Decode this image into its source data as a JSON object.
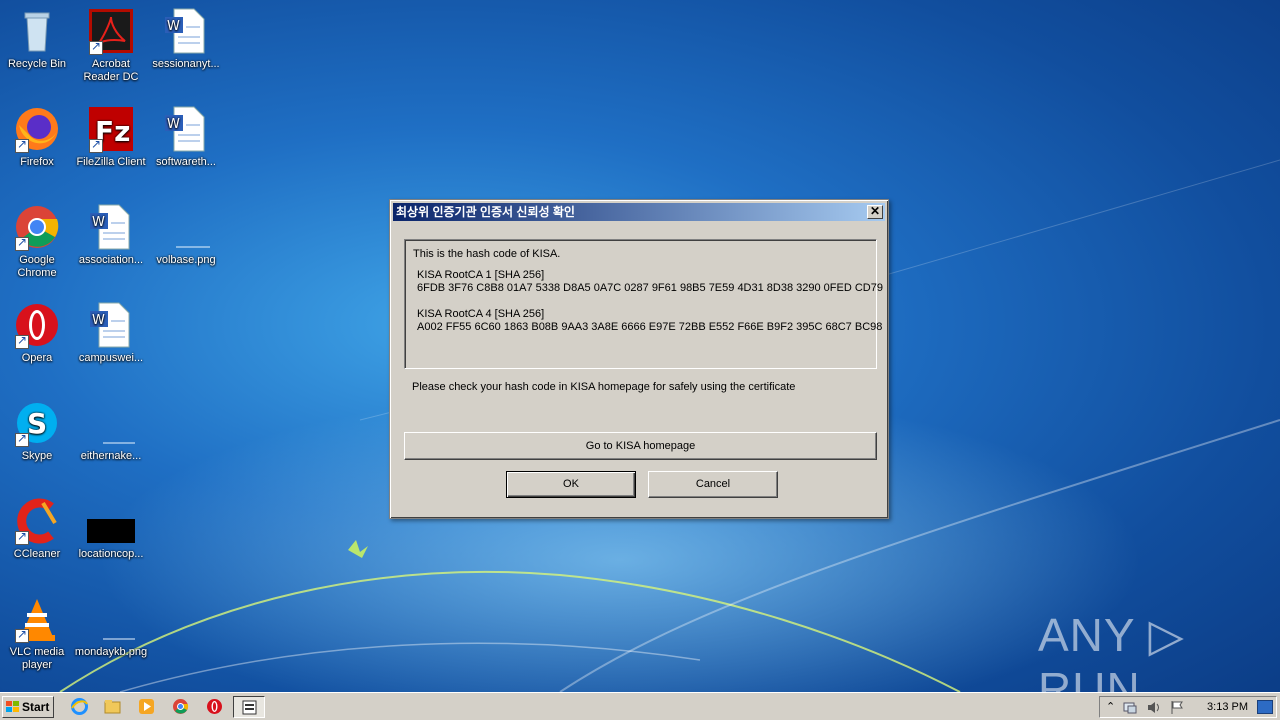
{
  "desktop": {
    "icons": [
      {
        "label_lines": [
          "Recycle Bin"
        ],
        "icon": "recycle-bin-icon"
      },
      {
        "label_lines": [
          "Acrobat",
          "Reader DC"
        ],
        "icon": "acrobat-icon"
      },
      {
        "label_lines": [
          "sessionanyt..."
        ],
        "icon": "word-doc-icon"
      },
      {
        "label_lines": [
          "Firefox"
        ],
        "icon": "firefox-icon"
      },
      {
        "label_lines": [
          "FileZilla Client"
        ],
        "icon": "filezilla-icon"
      },
      {
        "label_lines": [
          "softwareth..."
        ],
        "icon": "word-doc-icon"
      },
      {
        "label_lines": [
          "Google",
          "Chrome"
        ],
        "icon": "chrome-icon"
      },
      {
        "label_lines": [
          "association..."
        ],
        "icon": "word-doc-icon"
      },
      {
        "label_lines": [
          "volbase.png"
        ],
        "icon": "png-file-icon"
      },
      {
        "label_lines": [
          "Opera"
        ],
        "icon": "opera-icon"
      },
      {
        "label_lines": [
          "campuswei..."
        ],
        "icon": "word-doc-icon"
      },
      {
        "label_lines": [
          "Skype"
        ],
        "icon": "skype-icon"
      },
      {
        "label_lines": [
          "eithernake..."
        ],
        "icon": "blank-file-icon"
      },
      {
        "label_lines": [
          "CCleaner"
        ],
        "icon": "ccleaner-icon"
      },
      {
        "label_lines": [
          "locationcop..."
        ],
        "icon": "black-image-icon"
      },
      {
        "label_lines": [
          "VLC media",
          "player"
        ],
        "icon": "vlc-icon"
      },
      {
        "label_lines": [
          "mondaykb.png"
        ],
        "icon": "png-file-icon"
      }
    ]
  },
  "dialog": {
    "title": "최상위 인증기관 인증서 신뢰성 확인",
    "close_symbol": "✕",
    "intro": "This is the hash code of KISA.",
    "certs": [
      {
        "name": "KISA RootCA 1 [SHA 256]",
        "hash": "6FDB 3F76 C8B8 01A7 5338 D8A5 0A7C 0287 9F61 98B5 7E59 4D31 8D38 3290 0FED CD79"
      },
      {
        "name": "KISA RootCA 4 [SHA 256]",
        "hash": "A002 FF55 6C60 1863 B08B 9AA3 3A8E 6666 E97E 72BB E552 F66E B9F2 395C 68C7 BC98"
      }
    ],
    "check_message": "Please check your hash code in KISA homepage for safely using the certificate",
    "homepage_button": "Go to KISA homepage",
    "ok_button": "OK",
    "cancel_button": "Cancel"
  },
  "taskbar": {
    "start_label": "Start",
    "clock": "3:13 PM",
    "pinned": [
      "internet-explorer-icon",
      "explorer-folder-icon",
      "media-player-icon",
      "chrome-icon",
      "opera-icon",
      "active-window-icon"
    ]
  },
  "watermark": "ANY ▷ RUN",
  "colors": {
    "titlebar_start": "#0a246a",
    "titlebar_end": "#a6caf0",
    "dialog_face": "#d4d0c8"
  }
}
